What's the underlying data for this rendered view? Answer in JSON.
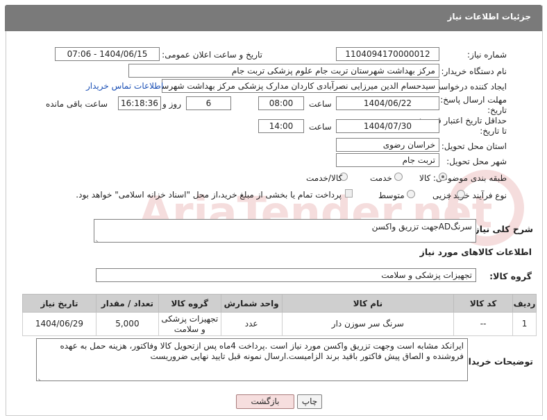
{
  "window": {
    "title": "جزئیات اطلاعات نیاز"
  },
  "fields": {
    "need_number_label": "شماره نیاز:",
    "need_number": "1104094170000012",
    "announce_label": "تاریخ و ساعت اعلان عمومی:",
    "announce_value": "1404/06/15 - 07:06",
    "buyer_org_label": "نام دستگاه خریدار:",
    "buyer_org": "مرکز بهداشت شهرستان تربت جام  علوم پزشکی تربت جام",
    "creator_label": "ایجاد کننده درخواست:",
    "creator": "سیدحسام الدین میرزایی نصرآبادی کاردان مدارک پزشکی مرکز بهداشت شهرستان",
    "contact_link": "اطلاعات تماس خریدار",
    "deadline_label_1": "مهلت ارسال پاسخ: تا",
    "deadline_label_2": "تاریخ:",
    "deadline_date": "1404/06/22",
    "time_label": "ساعت",
    "deadline_time": "08:00",
    "days_value": "6",
    "days_label": "روز و",
    "remaining_time": "16:18:36",
    "remaining_label": "ساعت باقی مانده",
    "validity_label_1": "حداقل تاریخ اعتبار قیمت:",
    "validity_label_2": "تا تاریخ:",
    "validity_date": "1404/07/30",
    "validity_time": "14:00",
    "province_label": "استان محل تحویل:",
    "province": "خراسان رضوی",
    "city_label": "شهر محل تحویل:",
    "city": "تربت جام",
    "category_label": "طبقه بندی موضوعی:",
    "category_goods": "کالا",
    "category_service": "خدمت",
    "category_both": "کالا/خدمت",
    "purchase_type_label": "نوع فرآیند خرید :",
    "purchase_partial": "جزیی",
    "purchase_medium": "متوسط",
    "payment_note": "پرداخت تمام یا بخشی از مبلغ خرید،از محل \"اسناد خزانه اسلامی\" خواهد بود."
  },
  "general_desc": {
    "label": "شرح کلی نیاز:",
    "value": "سرنگADجهت تزریق واکسن"
  },
  "goods_section": {
    "heading": "اطلاعات کالاهای مورد نیاز",
    "group_label": "گروه کالا:",
    "group_value": "تجهیزات پزشکی و سلامت"
  },
  "table": {
    "headers": {
      "row": "ردیف",
      "code": "کد کالا",
      "name": "نام کالا",
      "unit": "واحد شمارش",
      "group": "گروه کالا",
      "qty": "تعداد / مقدار",
      "date": "تاریخ نیاز"
    },
    "rows": [
      {
        "row": "1",
        "code": "--",
        "name": "سرنگ سر سوزن دار",
        "unit": "عدد",
        "group": "تجهیزات پزشکی و سلامت",
        "qty": "5,000",
        "date": "1404/06/29"
      }
    ]
  },
  "buyer_notes": {
    "label": "توضیحات خریدار:",
    "value": "ایرانکد مشابه است وجهت تزریق واکسن مورد نیاز است .پرداخت 4ماه پس ازتحویل کالا وفاکتور، هزینه حمل به عهده فروشنده و الصاق پیش فاکتور باقید برند الزامیست.ارسال نمونه قبل تایید نهایی ضروریست"
  },
  "buttons": {
    "print": "چاپ",
    "back": "بازگشت"
  },
  "watermark": {
    "brand": "AriaTender.net"
  },
  "colors": {
    "title_bg": "#7a7a7a",
    "link": "#1a4fb5",
    "back_button": "#f6dede",
    "table_header": "#cfcfcf"
  }
}
